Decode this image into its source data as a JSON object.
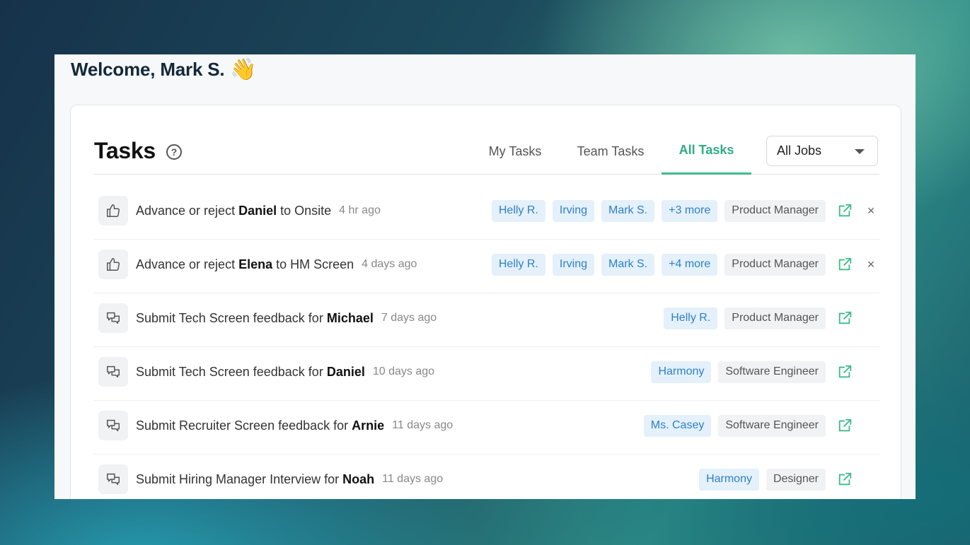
{
  "welcome": {
    "text": "Welcome, Mark S.",
    "emoji": "👋"
  },
  "tasks": {
    "title": "Tasks",
    "help": "?",
    "tabs": [
      {
        "label": "My Tasks",
        "active": false
      },
      {
        "label": "Team Tasks",
        "active": false
      },
      {
        "label": "All Tasks",
        "active": true
      }
    ],
    "filter": {
      "selected": "All Jobs"
    },
    "rows": [
      {
        "icon": "thumbs-up-icon",
        "prefix": "Advance or reject ",
        "name": "Daniel",
        "suffix": " to Onsite",
        "time": "4 hr ago",
        "people": [
          "Helly R.",
          "Irving",
          "Mark S.",
          "+3 more"
        ],
        "job": "Product Manager",
        "dismissible": true,
        "dismiss": "×"
      },
      {
        "icon": "thumbs-up-icon",
        "prefix": "Advance or reject ",
        "name": "Elena",
        "suffix": " to HM Screen",
        "time": "4 days ago",
        "people": [
          "Helly R.",
          "Irving",
          "Mark S.",
          "+4 more"
        ],
        "job": "Product Manager",
        "dismissible": true,
        "dismiss": "×"
      },
      {
        "icon": "chat-bubbles-icon",
        "prefix": "Submit Tech Screen feedback for ",
        "name": "Michael",
        "suffix": "",
        "time": "7 days ago",
        "people": [
          "Helly R."
        ],
        "job": "Product Manager",
        "dismissible": false
      },
      {
        "icon": "chat-bubbles-icon",
        "prefix": "Submit Tech Screen feedback for ",
        "name": "Daniel",
        "suffix": "",
        "time": "10 days ago",
        "people": [
          "Harmony"
        ],
        "job": "Software Engineer",
        "dismissible": false
      },
      {
        "icon": "chat-bubbles-icon",
        "prefix": "Submit Recruiter Screen feedback for ",
        "name": "Arnie",
        "suffix": "",
        "time": "11 days ago",
        "people": [
          "Ms. Casey"
        ],
        "job": "Software Engineer",
        "dismissible": false
      },
      {
        "icon": "chat-bubbles-icon",
        "prefix": "Submit Hiring Manager Interview for ",
        "name": "Noah",
        "suffix": "",
        "time": "11 days ago",
        "people": [
          "Harmony"
        ],
        "job": "Designer",
        "dismissible": false
      }
    ]
  },
  "colors": {
    "accent": "#2fae82",
    "person_chip_bg": "#e4f1fb",
    "person_chip_text": "#2f7fc9",
    "job_chip_bg": "#f1f2f3"
  }
}
